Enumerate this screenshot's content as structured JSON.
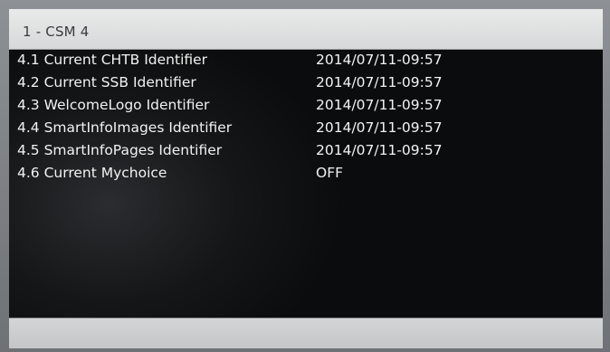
{
  "header": {
    "title": "1 - CSM 4"
  },
  "rows": [
    {
      "label": "4.1 Current CHTB Identifier",
      "value": "2014/07/11-09:57"
    },
    {
      "label": "4.2 Current SSB Identifier",
      "value": "2014/07/11-09:57"
    },
    {
      "label": "4.3 WelcomeLogo Identifier",
      "value": "2014/07/11-09:57"
    },
    {
      "label": "4.4 SmartInfoImages Identifier",
      "value": "2014/07/11-09:57"
    },
    {
      "label": "4.5 SmartInfoPages Identifier",
      "value": "2014/07/11-09:57"
    },
    {
      "label": "4.6 Current Mychoice",
      "value": "OFF"
    }
  ]
}
